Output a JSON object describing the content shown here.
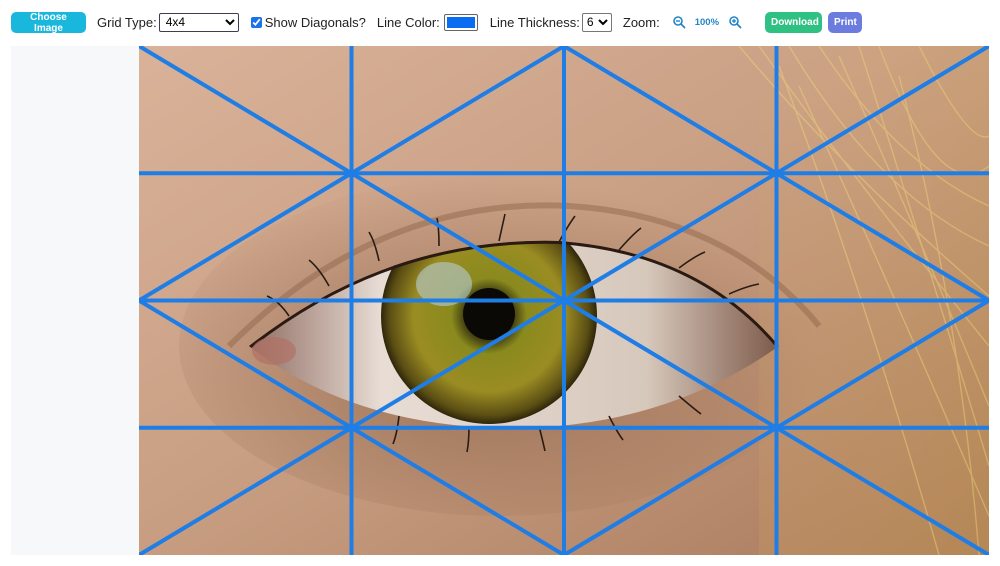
{
  "toolbar": {
    "choose_image_label": "Choose Image",
    "grid_type_label": "Grid Type:",
    "grid_type_value": "4x4",
    "show_diagonals_label": "Show Diagonals?",
    "show_diagonals_checked": true,
    "line_color_label": "Line Color:",
    "line_color_value": "#0a6cf0",
    "line_thickness_label": "Line Thickness:",
    "line_thickness_value": "6",
    "zoom_label": "Zoom:",
    "zoom_value": "100%",
    "download_label": "Download",
    "print_label": "Print"
  },
  "icons": {
    "zoom_out": "zoom-out-icon",
    "zoom_in": "zoom-in-icon"
  },
  "grid": {
    "rows": 4,
    "cols": 4,
    "diagonals": true,
    "line_color": "#1f7de6"
  },
  "image": {
    "subject": "close-up photo of a green-hazel eye"
  }
}
